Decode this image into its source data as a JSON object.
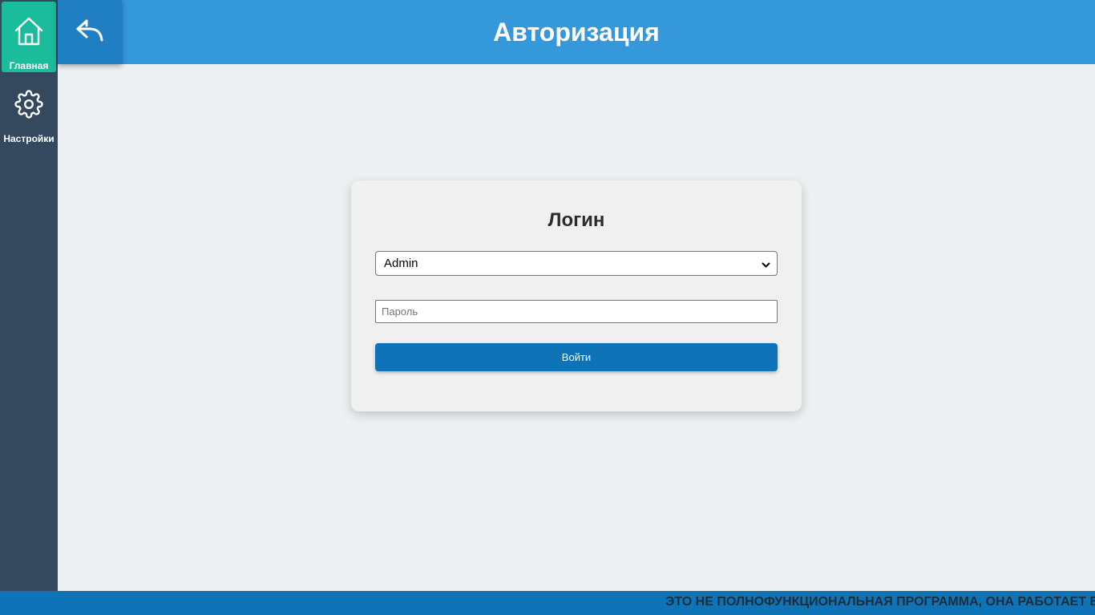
{
  "sidebar": {
    "items": [
      {
        "label": "Главная",
        "icon": "home-icon"
      },
      {
        "label": "Настройки",
        "icon": "gear-icon"
      }
    ]
  },
  "header": {
    "title": "Авторизация",
    "back_icon": "reply-arrow-icon"
  },
  "login": {
    "title": "Логин",
    "user_select_value": "Admin",
    "password_placeholder": "Пароль",
    "submit_label": "Войти"
  },
  "footer": {
    "ticker_text": "ЭТО НЕ ПОЛНОФУНКЦИОНАЛЬНАЯ ПРОГРАММА, ОНА РАБОТАЕТ В"
  },
  "colors": {
    "sidebar": "#34495e",
    "active_item": "#1abc9c",
    "header": "#3498db",
    "back_button": "#1f7fc2",
    "primary_button": "#0e74b7",
    "background": "#ecf0f1"
  }
}
